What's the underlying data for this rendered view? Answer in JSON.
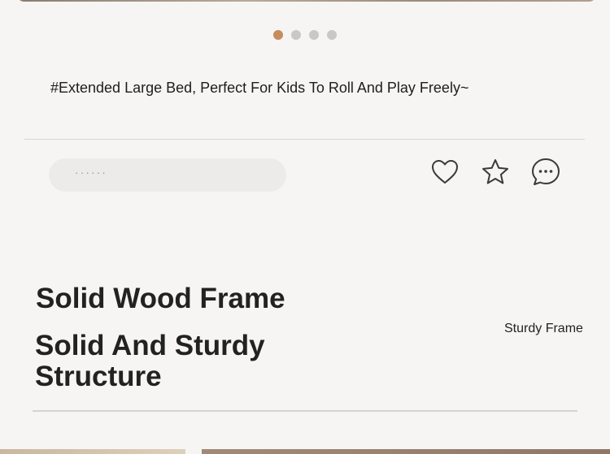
{
  "carousel": {
    "slides": 4,
    "active_index": 0,
    "colors": {
      "active": "#c58c5e",
      "inactive": "#c8c8c8"
    }
  },
  "caption": "#Extended Large Bed, Perfect For Kids To Roll And Play Freely~",
  "comment": {
    "placeholder": "······"
  },
  "actions": [
    {
      "name": "like",
      "icon": "heart-icon"
    },
    {
      "name": "favorite",
      "icon": "star-icon"
    },
    {
      "name": "comment",
      "icon": "chat-bubble-icon"
    }
  ],
  "feature": {
    "title": "Solid Wood Frame",
    "subtitle": "Solid And Sturdy Structure",
    "tag": "Sturdy Frame"
  }
}
